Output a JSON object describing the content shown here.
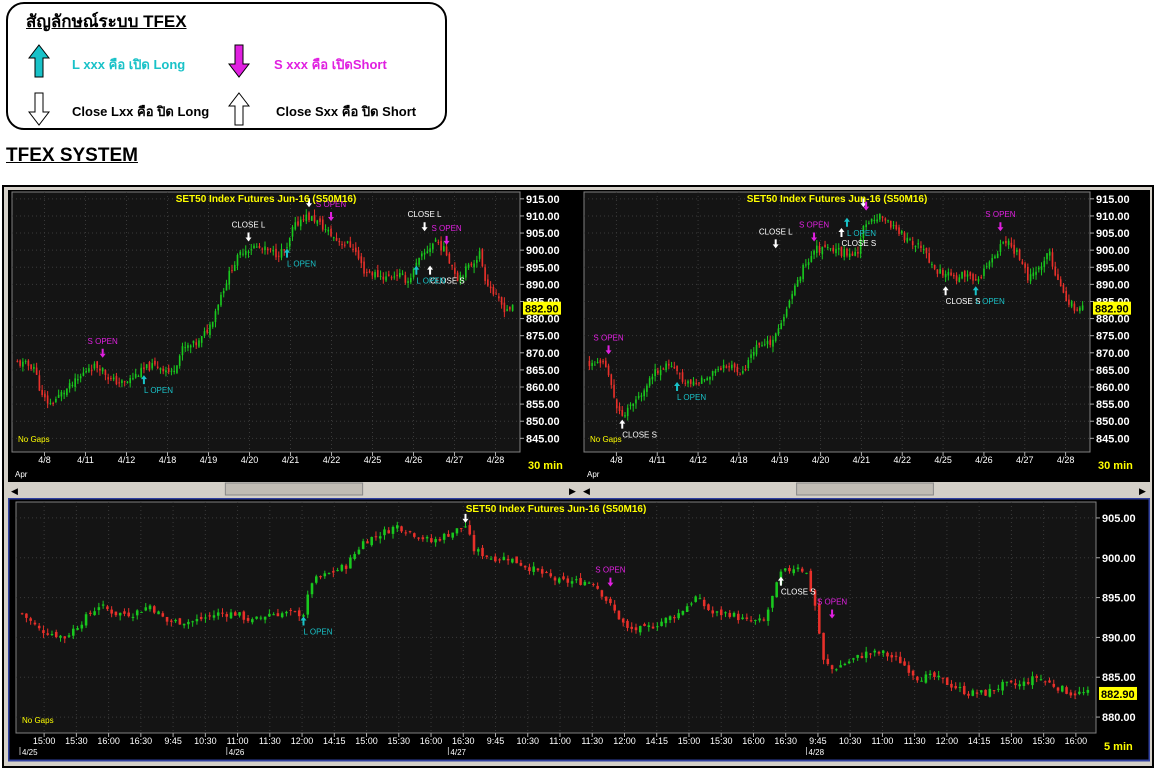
{
  "legend": {
    "title": "สัญลักษณ์ระบบ TFEX",
    "long_open": "L xxx คือ เปิด Long",
    "short_open": "S xxx คือ เปิดShort",
    "long_close": "Close Lxx คือ ปิด Long",
    "short_close": "Close Sxx คือ ปิด Short",
    "colors": {
      "long_open": "#19c2c8",
      "short_open": "#e020e0",
      "close": "#ffffff"
    }
  },
  "page_title": "TFEX SYSTEM",
  "chart_data": [
    {
      "type": "candlestick",
      "title": "SET50 Index Futures Jun-16 (S50M16)",
      "timeframe": "30 min",
      "gaps_label": "No Gaps",
      "last_price": "882.90",
      "ylim": [
        841,
        917
      ],
      "yticks": [
        "915.00",
        "910.00",
        "905.00",
        "900.00",
        "895.00",
        "890.00",
        "885.00",
        "880.00",
        "875.00",
        "870.00",
        "865.00",
        "860.00",
        "855.00",
        "850.00",
        "845.00"
      ],
      "x_period_label": "Apr",
      "xticks": [
        "4/8",
        "4/11",
        "4/12",
        "4/18",
        "4/19",
        "4/20",
        "4/21",
        "4/22",
        "4/25",
        "4/26",
        "4/27",
        "4/28"
      ],
      "close_path": [
        [
          0,
          867
        ],
        [
          6,
          866
        ],
        [
          9,
          857
        ],
        [
          12,
          855
        ],
        [
          16,
          858
        ],
        [
          22,
          862
        ],
        [
          26,
          866
        ],
        [
          30,
          866
        ],
        [
          34,
          862
        ],
        [
          39,
          861
        ],
        [
          44,
          864
        ],
        [
          48,
          866
        ],
        [
          52,
          866
        ],
        [
          56,
          864
        ],
        [
          60,
          871
        ],
        [
          66,
          873
        ],
        [
          70,
          878
        ],
        [
          74,
          887
        ],
        [
          78,
          895
        ],
        [
          82,
          900
        ],
        [
          86,
          901
        ],
        [
          90,
          900
        ],
        [
          94,
          899
        ],
        [
          98,
          900
        ],
        [
          100,
          906
        ],
        [
          104,
          910
        ],
        [
          108,
          909
        ],
        [
          112,
          906
        ],
        [
          116,
          903
        ],
        [
          122,
          901
        ],
        [
          126,
          894
        ],
        [
          130,
          893
        ],
        [
          134,
          892
        ],
        [
          138,
          893
        ],
        [
          142,
          891
        ],
        [
          146,
          897
        ],
        [
          150,
          901
        ],
        [
          152,
          903
        ],
        [
          156,
          899
        ],
        [
          160,
          892
        ],
        [
          164,
          895
        ],
        [
          168,
          899
        ],
        [
          170,
          892
        ],
        [
          174,
          886
        ],
        [
          177,
          883
        ],
        [
          180,
          883
        ]
      ],
      "markers": [
        {
          "label": "S OPEN",
          "kind": "short_open",
          "i": 31,
          "p": 870
        },
        {
          "label": "L OPEN",
          "kind": "long_open",
          "i": 46,
          "p": 862
        },
        {
          "label": "CLOSE L",
          "kind": "close_long",
          "i": 84,
          "p": 904
        },
        {
          "label": "L OPEN",
          "kind": "long_open",
          "i": 98,
          "p": 899
        },
        {
          "label": "",
          "kind": "close_long",
          "i": 106,
          "p": 914
        },
        {
          "label": "S OPEN",
          "kind": "short_open",
          "i": 114,
          "p": 910
        },
        {
          "label": "CLOSE L",
          "kind": "close_long",
          "i": 148,
          "p": 907
        },
        {
          "label": "S OPEN",
          "kind": "short_open",
          "i": 156,
          "p": 903
        },
        {
          "label": "CLOSE S",
          "kind": "close_short",
          "i": 150,
          "p": 894
        },
        {
          "label": "L OPEN",
          "kind": "long_open",
          "i": 145,
          "p": 894
        }
      ]
    },
    {
      "type": "candlestick",
      "title": "SET50 Index Futures Jun-16 (S50M16)",
      "timeframe": "30 min",
      "gaps_label": "No Gaps",
      "last_price": "882.90",
      "ylim": [
        841,
        917
      ],
      "yticks": [
        "915.00",
        "910.00",
        "905.00",
        "900.00",
        "895.00",
        "890.00",
        "885.00",
        "880.00",
        "875.00",
        "870.00",
        "865.00",
        "860.00",
        "855.00",
        "850.00",
        "845.00"
      ],
      "x_period_label": "Apr",
      "xticks": [
        "4/8",
        "4/11",
        "4/12",
        "4/18",
        "4/19",
        "4/20",
        "4/21",
        "4/22",
        "4/25",
        "4/26",
        "4/27",
        "4/28"
      ],
      "close_path": [
        [
          0,
          867
        ],
        [
          6,
          866
        ],
        [
          9,
          857
        ],
        [
          12,
          851
        ],
        [
          16,
          855
        ],
        [
          22,
          862
        ],
        [
          26,
          866
        ],
        [
          30,
          866
        ],
        [
          34,
          862
        ],
        [
          39,
          861
        ],
        [
          44,
          864
        ],
        [
          48,
          866
        ],
        [
          52,
          866
        ],
        [
          56,
          864
        ],
        [
          60,
          871
        ],
        [
          66,
          873
        ],
        [
          70,
          878
        ],
        [
          74,
          887
        ],
        [
          78,
          895
        ],
        [
          82,
          900
        ],
        [
          86,
          901
        ],
        [
          90,
          900
        ],
        [
          94,
          899
        ],
        [
          98,
          900
        ],
        [
          100,
          906
        ],
        [
          104,
          910
        ],
        [
          108,
          909
        ],
        [
          112,
          906
        ],
        [
          116,
          903
        ],
        [
          122,
          901
        ],
        [
          126,
          894
        ],
        [
          130,
          893
        ],
        [
          134,
          892
        ],
        [
          138,
          893
        ],
        [
          142,
          891
        ],
        [
          146,
          897
        ],
        [
          150,
          901
        ],
        [
          152,
          903
        ],
        [
          156,
          899
        ],
        [
          160,
          892
        ],
        [
          164,
          895
        ],
        [
          168,
          899
        ],
        [
          170,
          892
        ],
        [
          174,
          886
        ],
        [
          177,
          883
        ],
        [
          180,
          883
        ]
      ],
      "markers": [
        {
          "label": "S OPEN",
          "kind": "short_open",
          "i": 7,
          "p": 871
        },
        {
          "label": "CLOSE S",
          "kind": "close_short",
          "i": 12,
          "p": 849
        },
        {
          "label": "L OPEN",
          "kind": "long_open",
          "i": 32,
          "p": 860
        },
        {
          "label": "CLOSE L",
          "kind": "close_long",
          "i": 68,
          "p": 902
        },
        {
          "label": "S OPEN",
          "kind": "short_open",
          "i": 82,
          "p": 904
        },
        {
          "label": "CLOSE S",
          "kind": "close_short",
          "i": 92,
          "p": 905
        },
        {
          "label": "L OPEN",
          "kind": "long_open",
          "i": 94,
          "p": 908
        },
        {
          "label": "",
          "kind": "close_long",
          "i": 100,
          "p": 914
        },
        {
          "label": "",
          "kind": "short_open",
          "i": 101,
          "p": 913
        },
        {
          "label": "CLOSE S",
          "kind": "close_short",
          "i": 130,
          "p": 888
        },
        {
          "label": "L OPEN",
          "kind": "long_open",
          "i": 141,
          "p": 888
        },
        {
          "label": "S OPEN",
          "kind": "short_open",
          "i": 150,
          "p": 907
        }
      ]
    },
    {
      "type": "candlestick",
      "title": "SET50 Index Futures Jun-16 (S50M16)",
      "timeframe": "5 min",
      "gaps_label": "No Gaps",
      "last_price": "882.90",
      "ylim": [
        878,
        907
      ],
      "yticks": [
        "905.00",
        "900.00",
        "895.00",
        "890.00",
        "885.00",
        "880.00"
      ],
      "date_labels": [
        [
          "4/25",
          0
        ],
        [
          "4/26",
          48
        ],
        [
          "4/27",
          100
        ],
        [
          "4/28",
          184
        ]
      ],
      "xticks": [
        "15:00",
        "15:30",
        "16:00",
        "16:30",
        "9:45",
        "10:30",
        "11:00",
        "11:30",
        "12:00",
        "14:15",
        "15:00",
        "15:30",
        "16:00",
        "16:30",
        "9:45",
        "10:30",
        "11:00",
        "11:30",
        "12:00",
        "14:15",
        "15:00",
        "15:30",
        "16:00",
        "16:30",
        "9:45",
        "10:30",
        "11:00",
        "11:30",
        "12:00",
        "14:15",
        "15:00",
        "15:30",
        "16:00"
      ],
      "close_path": [
        [
          0,
          893
        ],
        [
          4,
          891
        ],
        [
          10,
          890
        ],
        [
          14,
          892
        ],
        [
          18,
          894
        ],
        [
          22,
          893
        ],
        [
          26,
          893
        ],
        [
          30,
          894
        ],
        [
          34,
          892
        ],
        [
          40,
          892
        ],
        [
          46,
          893
        ],
        [
          50,
          893
        ],
        [
          54,
          892
        ],
        [
          58,
          893
        ],
        [
          62,
          893
        ],
        [
          66,
          893
        ],
        [
          68,
          897
        ],
        [
          72,
          898
        ],
        [
          76,
          899
        ],
        [
          80,
          902
        ],
        [
          84,
          903
        ],
        [
          88,
          904
        ],
        [
          92,
          903
        ],
        [
          96,
          902
        ],
        [
          100,
          903
        ],
        [
          104,
          904
        ],
        [
          106,
          901
        ],
        [
          110,
          900
        ],
        [
          114,
          900
        ],
        [
          118,
          899
        ],
        [
          122,
          898
        ],
        [
          126,
          897
        ],
        [
          130,
          897
        ],
        [
          134,
          897
        ],
        [
          138,
          894
        ],
        [
          142,
          891
        ],
        [
          146,
          891
        ],
        [
          150,
          892
        ],
        [
          154,
          893
        ],
        [
          158,
          895
        ],
        [
          162,
          893
        ],
        [
          166,
          893
        ],
        [
          170,
          892
        ],
        [
          174,
          892
        ],
        [
          178,
          898
        ],
        [
          182,
          899
        ],
        [
          184,
          898
        ],
        [
          186,
          894
        ],
        [
          188,
          887
        ],
        [
          190,
          886
        ],
        [
          194,
          887
        ],
        [
          198,
          888
        ],
        [
          202,
          888
        ],
        [
          206,
          887
        ],
        [
          210,
          885
        ],
        [
          214,
          885
        ],
        [
          218,
          884
        ],
        [
          222,
          883
        ],
        [
          226,
          883
        ],
        [
          230,
          884
        ],
        [
          234,
          884
        ],
        [
          238,
          885
        ],
        [
          242,
          884
        ],
        [
          246,
          883
        ],
        [
          250,
          883
        ]
      ],
      "markers": [
        {
          "label": "L OPEN",
          "kind": "long_open",
          "i": 66,
          "p": 892
        },
        {
          "label": "",
          "kind": "close_long",
          "i": 104,
          "p": 905
        },
        {
          "label": "S OPEN",
          "kind": "short_open",
          "i": 138,
          "p": 897
        },
        {
          "label": "CLOSE S",
          "kind": "close_short",
          "i": 178,
          "p": 897
        },
        {
          "label": "S OPEN",
          "kind": "short_open",
          "i": 190,
          "p": 893
        }
      ]
    }
  ]
}
